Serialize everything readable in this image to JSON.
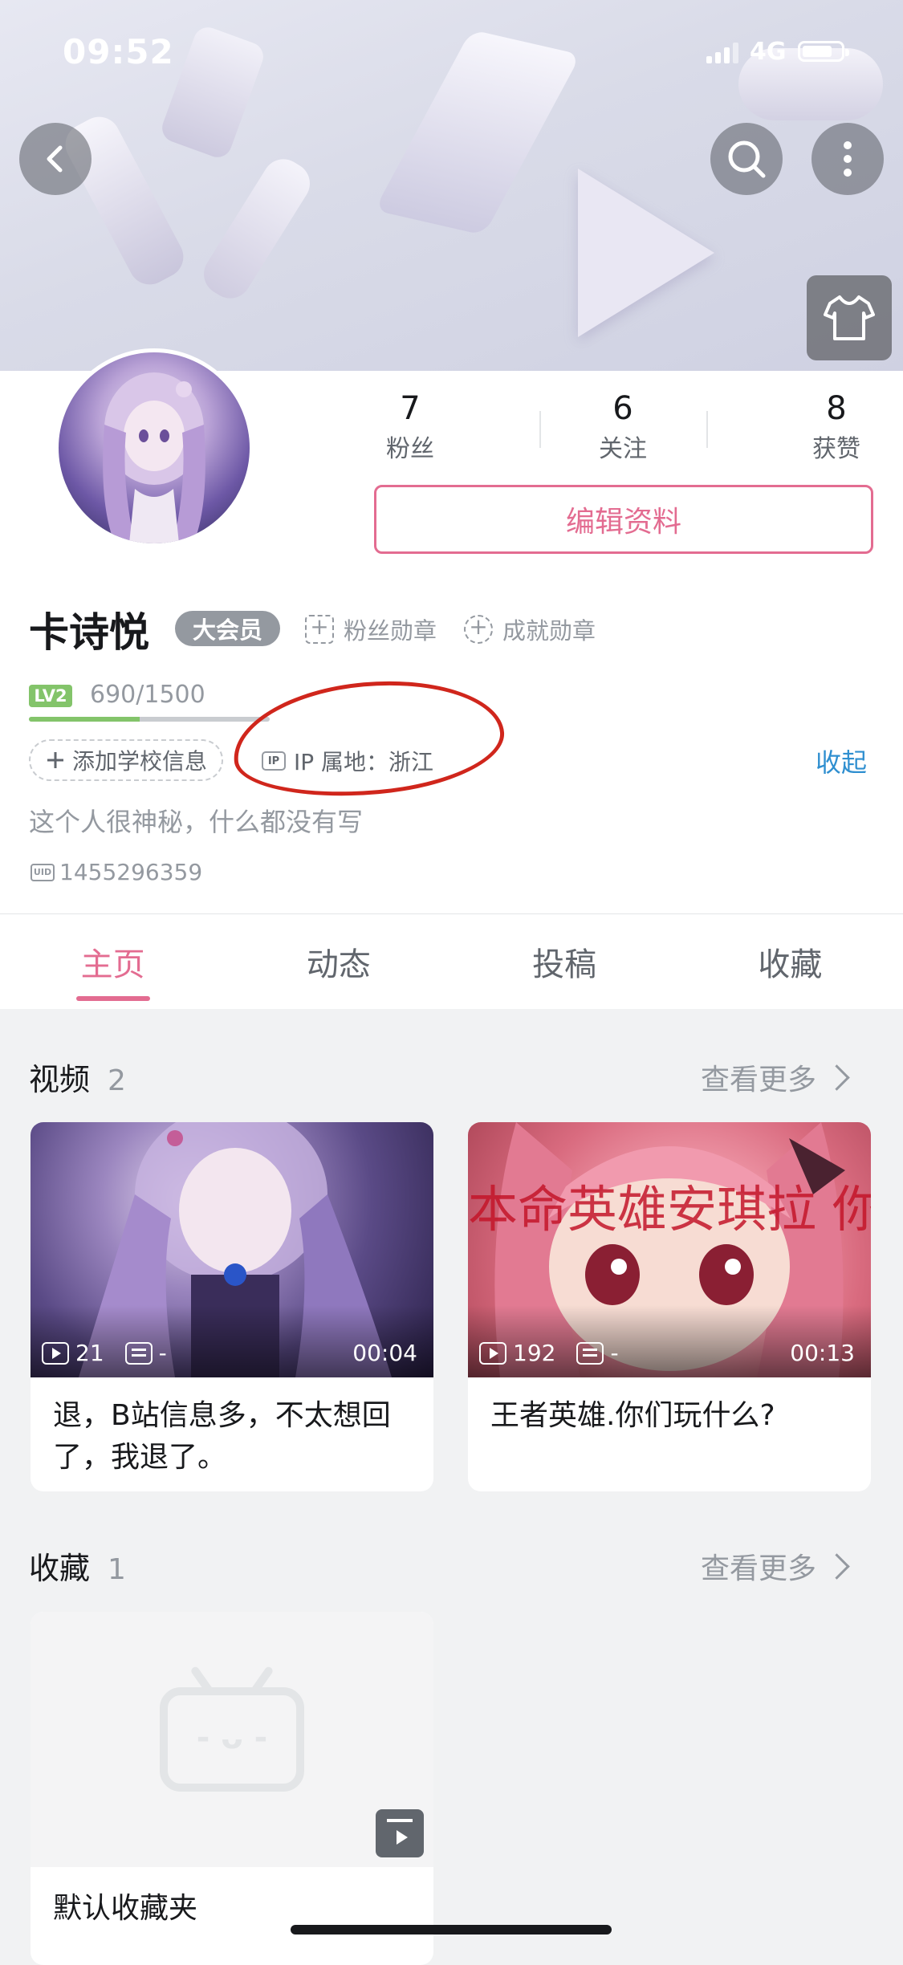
{
  "status_bar": {
    "time": "09:52",
    "network": "4G"
  },
  "profile": {
    "stats": [
      {
        "value": "7",
        "label": "粉丝"
      },
      {
        "value": "6",
        "label": "关注"
      },
      {
        "value": "8",
        "label": "获赞"
      }
    ],
    "edit_button": "编辑资料",
    "name": "卡诗悦",
    "vip_badge": "大会员",
    "fan_medal": "粉丝勋章",
    "achievement_medal": "成就勋章",
    "level_badge": "LV2",
    "level_exp": "690/1500",
    "level_progress": 0.46,
    "add_school": "添加学校信息",
    "ip_icon": "IP",
    "ip_location": "IP 属地：浙江",
    "collapse": "收起",
    "bio": "这个人很神秘，什么都没有写",
    "uid_icon": "UID",
    "uid": "1455296359"
  },
  "tabs": [
    "主页",
    "动态",
    "投稿",
    "收藏"
  ],
  "videos_section": {
    "title": "视频",
    "count": "2",
    "more": "查看更多",
    "items": [
      {
        "plays": "21",
        "danmaku": "-",
        "duration": "00:04",
        "title": "退，B站信息多，不太想回了，我退了。",
        "overlay": ""
      },
      {
        "plays": "192",
        "danmaku": "-",
        "duration": "00:13",
        "title": "王者英雄.你们玩什么?",
        "overlay": "本命英雄安琪拉 你们玩什么?"
      }
    ]
  },
  "favorites_section": {
    "title": "收藏",
    "count": "1",
    "more": "查看更多",
    "items": [
      {
        "title": "默认收藏夹",
        "face": "- ᴗ -"
      }
    ]
  },
  "colors": {
    "accent": "#e36c91",
    "link": "#2f8fd0",
    "level": "#83c46a",
    "annotation": "#d0261c"
  }
}
